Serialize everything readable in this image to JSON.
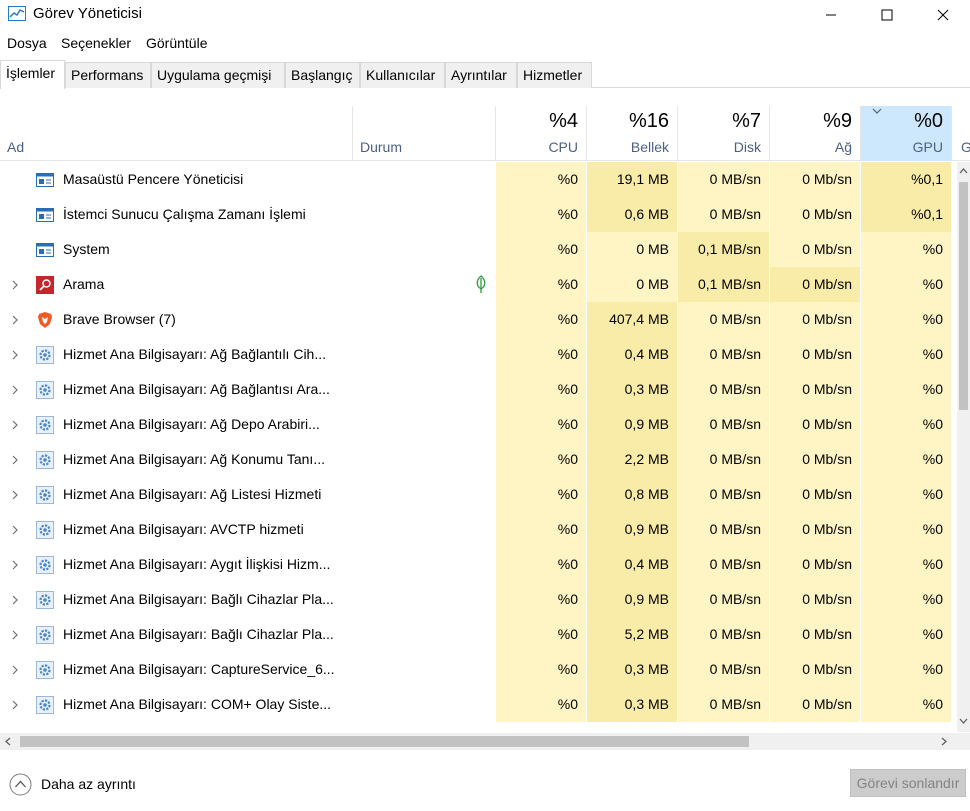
{
  "window": {
    "title": "Görev Yöneticisi"
  },
  "menu": [
    "Dosya",
    "Seçenekler",
    "Görüntüle"
  ],
  "tabs": [
    "İşlemler",
    "Performans",
    "Uygulama geçmişi",
    "Başlangıç",
    "Kullanıcılar",
    "Ayrıntılar",
    "Hizmetler"
  ],
  "active_tab": "İşlemler",
  "header": {
    "name": "Ad",
    "status": "Durum",
    "cpu_pct": "%4",
    "cpu": "CPU",
    "mem_pct": "%16",
    "mem": "Bellek",
    "disk_pct": "%7",
    "disk": "Disk",
    "net_pct": "%9",
    "net": "Ağ",
    "gpu_pct": "%0",
    "gpu": "GPU",
    "gpu_engine_cut": "G"
  },
  "rows": [
    {
      "name": "Masaüstü Pencere Yöneticisi",
      "icon": "window-app-icon",
      "expandable": false,
      "cpu": "%0",
      "mem": "19,1 MB",
      "disk": "0 MB/sn",
      "net": "0 Mb/sn",
      "gpu": "%0,1"
    },
    {
      "name": "İstemci Sunucu Çalışma Zamanı İşlemi",
      "icon": "window-app-icon",
      "expandable": false,
      "cpu": "%0",
      "mem": "0,6 MB",
      "disk": "0 MB/sn",
      "net": "0 Mb/sn",
      "gpu": "%0,1"
    },
    {
      "name": "System",
      "icon": "window-app-icon",
      "expandable": false,
      "cpu": "%0",
      "mem": "0 MB",
      "disk": "0,1 MB/sn",
      "net": "0 Mb/sn",
      "gpu": "%0"
    },
    {
      "name": "Arama",
      "icon": "search-app-icon",
      "expandable": true,
      "suspended": true,
      "cpu": "%0",
      "mem": "0 MB",
      "disk": "0,1 MB/sn",
      "net": "0 Mb/sn",
      "gpu": "%0"
    },
    {
      "name": "Brave Browser (7)",
      "icon": "brave-icon",
      "expandable": true,
      "cpu": "%0",
      "mem": "407,4 MB",
      "disk": "0 MB/sn",
      "net": "0 Mb/sn",
      "gpu": "%0"
    },
    {
      "name": "Hizmet Ana Bilgisayarı: Ağ Bağlantılı Cih...",
      "icon": "service-gear-icon",
      "expandable": true,
      "cpu": "%0",
      "mem": "0,4 MB",
      "disk": "0 MB/sn",
      "net": "0 Mb/sn",
      "gpu": "%0"
    },
    {
      "name": "Hizmet Ana Bilgisayarı: Ağ Bağlantısı Ara...",
      "icon": "service-gear-icon",
      "expandable": true,
      "cpu": "%0",
      "mem": "0,3 MB",
      "disk": "0 MB/sn",
      "net": "0 Mb/sn",
      "gpu": "%0"
    },
    {
      "name": "Hizmet Ana Bilgisayarı: Ağ Depo Arabiri...",
      "icon": "service-gear-icon",
      "expandable": true,
      "cpu": "%0",
      "mem": "0,9 MB",
      "disk": "0 MB/sn",
      "net": "0 Mb/sn",
      "gpu": "%0"
    },
    {
      "name": "Hizmet Ana Bilgisayarı: Ağ Konumu Tanı...",
      "icon": "service-gear-icon",
      "expandable": true,
      "cpu": "%0",
      "mem": "2,2 MB",
      "disk": "0 MB/sn",
      "net": "0 Mb/sn",
      "gpu": "%0"
    },
    {
      "name": "Hizmet Ana Bilgisayarı: Ağ Listesi Hizmeti",
      "icon": "service-gear-icon",
      "expandable": true,
      "cpu": "%0",
      "mem": "0,8 MB",
      "disk": "0 MB/sn",
      "net": "0 Mb/sn",
      "gpu": "%0"
    },
    {
      "name": "Hizmet Ana Bilgisayarı: AVCTP hizmeti",
      "icon": "service-gear-icon",
      "expandable": true,
      "cpu": "%0",
      "mem": "0,9 MB",
      "disk": "0 MB/sn",
      "net": "0 Mb/sn",
      "gpu": "%0"
    },
    {
      "name": "Hizmet Ana Bilgisayarı: Aygıt İlişkisi Hizm...",
      "icon": "service-gear-icon",
      "expandable": true,
      "cpu": "%0",
      "mem": "0,4 MB",
      "disk": "0 MB/sn",
      "net": "0 Mb/sn",
      "gpu": "%0"
    },
    {
      "name": "Hizmet Ana Bilgisayarı: Bağlı Cihazlar Pla...",
      "icon": "service-gear-icon",
      "expandable": true,
      "cpu": "%0",
      "mem": "0,9 MB",
      "disk": "0 MB/sn",
      "net": "0 Mb/sn",
      "gpu": "%0"
    },
    {
      "name": "Hizmet Ana Bilgisayarı: Bağlı Cihazlar Pla...",
      "icon": "service-gear-icon",
      "expandable": true,
      "cpu": "%0",
      "mem": "5,2 MB",
      "disk": "0 MB/sn",
      "net": "0 Mb/sn",
      "gpu": "%0"
    },
    {
      "name": "Hizmet Ana Bilgisayarı: CaptureService_6...",
      "icon": "service-gear-icon",
      "expandable": true,
      "cpu": "%0",
      "mem": "0,3 MB",
      "disk": "0 MB/sn",
      "net": "0 Mb/sn",
      "gpu": "%0"
    },
    {
      "name": "Hizmet Ana Bilgisayarı: COM+ Olay Siste...",
      "icon": "service-gear-icon",
      "expandable": true,
      "cpu": "%0",
      "mem": "0,3 MB",
      "disk": "0 MB/sn",
      "net": "0 Mb/sn",
      "gpu": "%0"
    }
  ],
  "footer": {
    "fewer_details": "Daha az ayrıntı",
    "end_task": "Görevi sonlandır"
  },
  "colors": {
    "heat_light": "#fff4c4",
    "heat_mid": "#f9eca8",
    "heat_strong": "#ffe9a0",
    "gpu_header": "#cde8fc",
    "header_label": "#4d6082"
  }
}
